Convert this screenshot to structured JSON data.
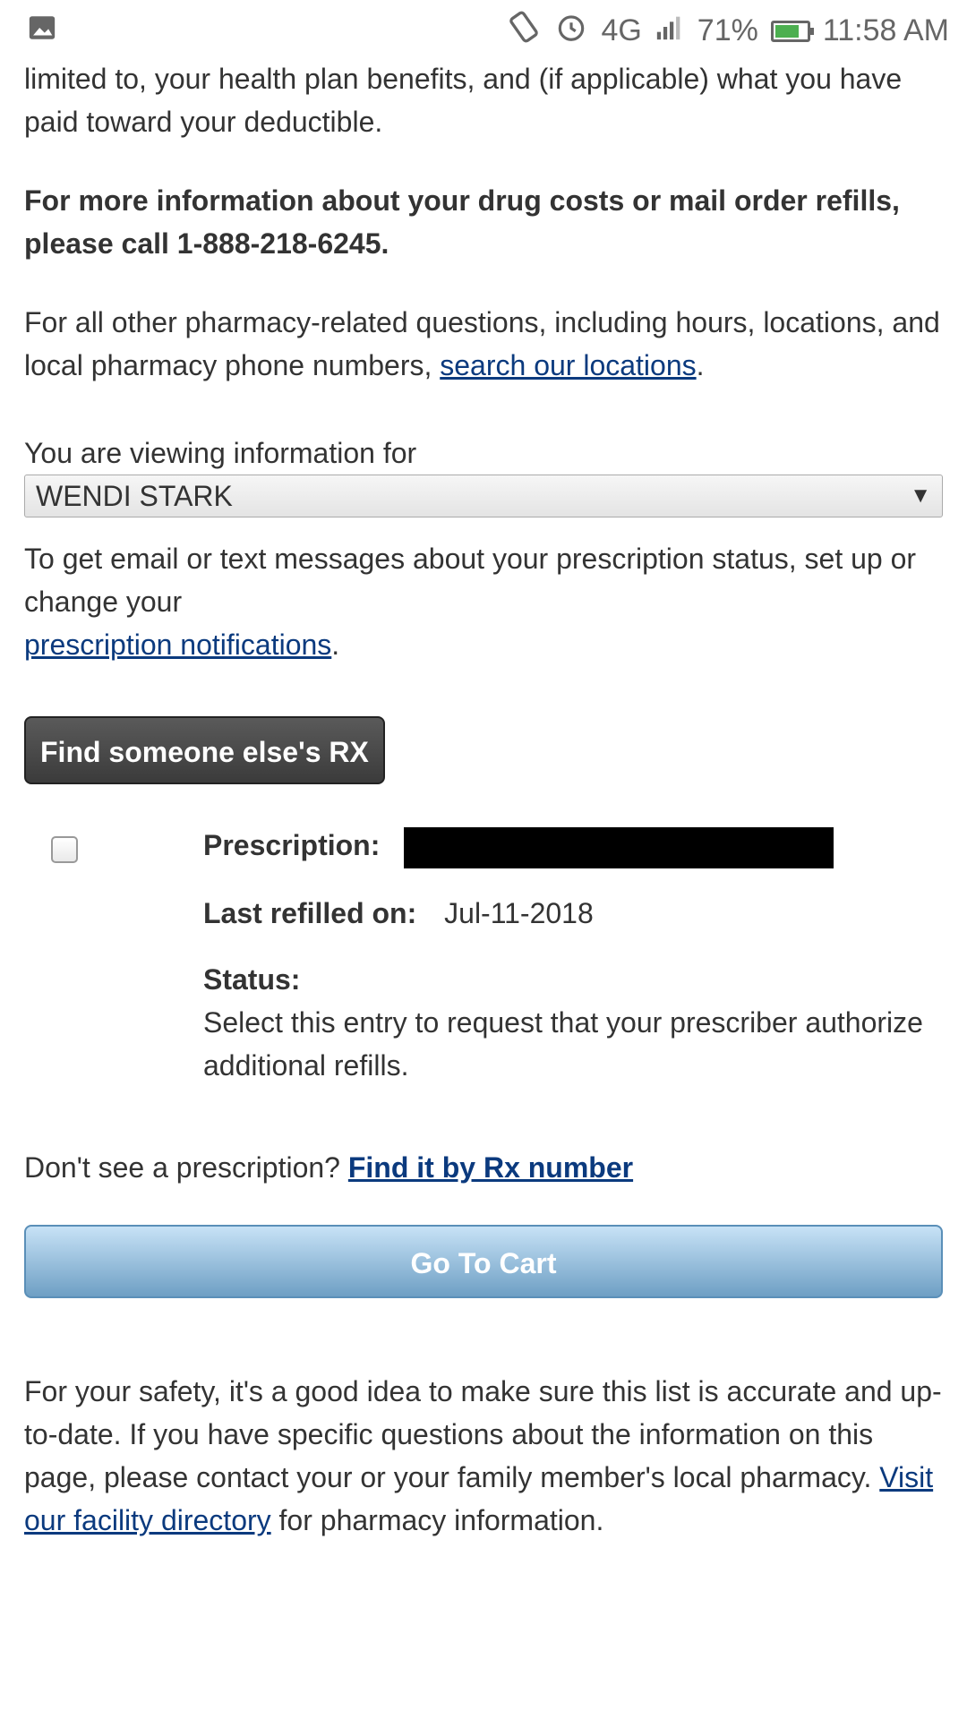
{
  "statusbar": {
    "battery_pct": "71%",
    "time": "11:58 AM",
    "network": "4G"
  },
  "intro": {
    "text": "limited to, your health plan benefits, and (if applicable) what you have paid toward your deductible."
  },
  "call": {
    "text": "For more information about your drug costs or mail order refills, please call 1-888-218-6245."
  },
  "other": {
    "text": "For all other pharmacy-related questions, including hours, locations, and local pharmacy phone numbers,",
    "link": "search our locations",
    "end": "."
  },
  "viewing": {
    "label": "You are viewing information for",
    "selected": "WENDI STARK"
  },
  "notifications": {
    "text": "To get email or text messages about your prescription status, set up or change your",
    "link": "prescription notifications",
    "end": "."
  },
  "find_button": "Find someone else's RX",
  "rx": {
    "prescription_label": "Prescription:",
    "last_refilled_label": "Last refilled on:",
    "last_refilled_value": "Jul-11-2018",
    "status_label": "Status:",
    "status_text": "Select this entry to request that your prescriber authorize additional refills."
  },
  "dont_see": {
    "text": "Don't see a prescription?",
    "link": "Find it by Rx number"
  },
  "cart_button": "Go To Cart",
  "safety": {
    "text": "For your safety, it's a good idea to make sure this list is accurate and up-to-date. If you have specific questions about the information on this page, please contact your or your family member's local pharmacy.",
    "link": "Visit our facility directory",
    "end": "for pharmacy information."
  }
}
